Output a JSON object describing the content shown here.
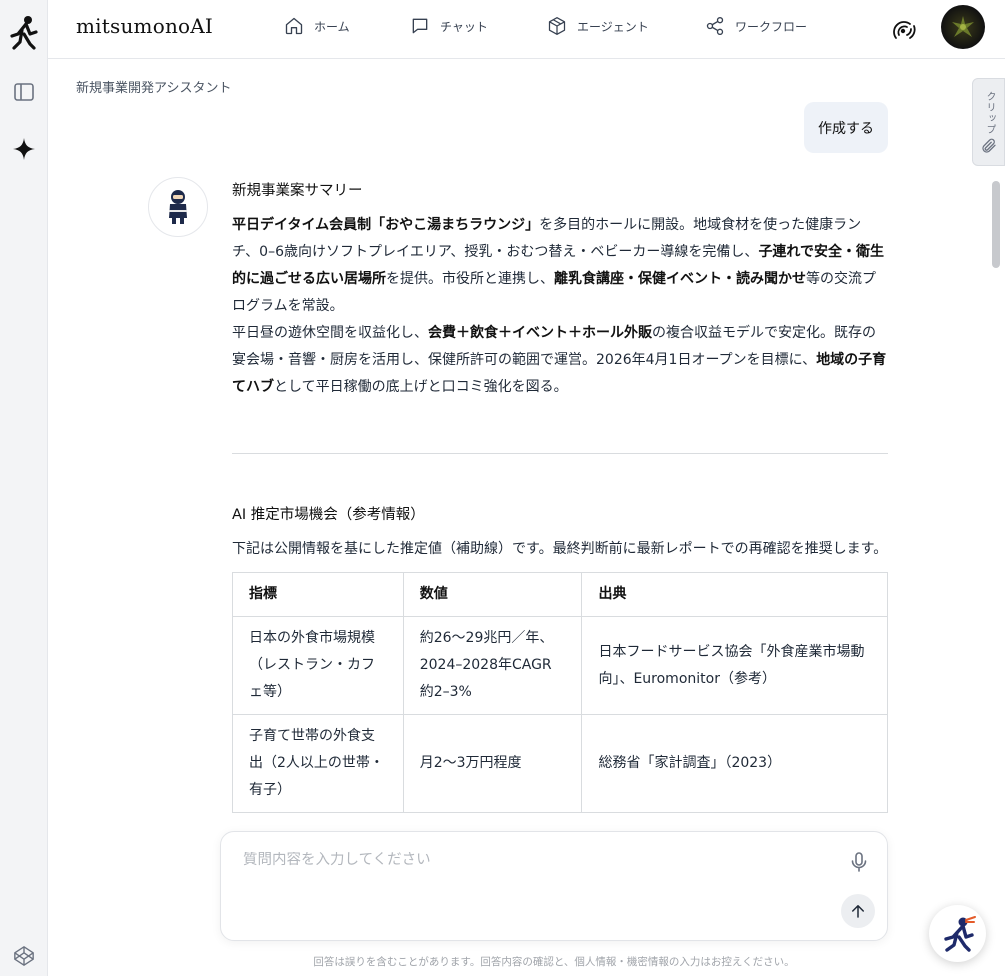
{
  "app": {
    "name": "mitsumonoAI"
  },
  "nav": {
    "items": [
      {
        "label": "ホーム",
        "icon": "home-icon"
      },
      {
        "label": "チャット",
        "icon": "chat-icon"
      },
      {
        "label": "エージェント",
        "icon": "cube-icon"
      },
      {
        "label": "ワークフロー",
        "icon": "share-icon"
      }
    ]
  },
  "assistant": {
    "name": "新規事業開発アシスタント"
  },
  "clip_tab": {
    "label": "クリップ"
  },
  "user_message": "作成する",
  "response": {
    "summary_title": "新規事業案サマリー",
    "p1": [
      {
        "t": "平日デイタイム会員制「おやこ湯まちラウンジ」",
        "b": true
      },
      {
        "t": "を多目的ホールに開設。地域食材を使った健康ランチ、0–6歳向けソフトプレイエリア、授乳・おむつ替え・ベビーカー導線を完備し、",
        "b": false
      },
      {
        "t": "子連れで安全・衛生的に過ごせる広い居場所",
        "b": true
      },
      {
        "t": "を提供。市役所と連携し、",
        "b": false
      },
      {
        "t": "離乳食講座・保健イベント・読み聞かせ",
        "b": true
      },
      {
        "t": "等の交流プログラムを常設。",
        "b": false
      }
    ],
    "p2": [
      {
        "t": "平日昼の遊休空間を収益化し、",
        "b": false
      },
      {
        "t": "会費＋飲食＋イベント＋ホール外販",
        "b": true
      },
      {
        "t": "の複合収益モデルで安定化。既存の宴会場・音響・厨房を活用し、保健所許可の範囲で運営。2026年4月1日オープンを目標に、",
        "b": false
      },
      {
        "t": "地域の子育てハブ",
        "b": true
      },
      {
        "t": "として平日稼働の底上げと口コミ強化を図る。",
        "b": false
      }
    ],
    "market_title": "AI 推定市場機会（参考情報）",
    "market_note": "下記は公開情報を基にした推定値（補助線）です。最終判断前に最新レポートでの再確認を推奨します。",
    "table": {
      "headers": [
        "指標",
        "数値",
        "出典"
      ],
      "rows": [
        [
          "日本の外食市場規模（レストラン・カフェ等）",
          "約26〜29兆円／年、2024–2028年CAGR約2–3%",
          "日本フードサービス協会「外食産業市場動向」、Euromonitor（参考）"
        ],
        [
          "子育て世帯の外食支出（2人以上の世帯・有子）",
          "月2〜3万円程度",
          "総務省「家計調査」（2023）"
        ]
      ]
    }
  },
  "composer": {
    "placeholder": "質問内容を入力してください"
  },
  "disclaimer": "回答は誤りを含むことがあります。回答内容の確認と、個人情報・機密情報の入力はお控えください。"
}
